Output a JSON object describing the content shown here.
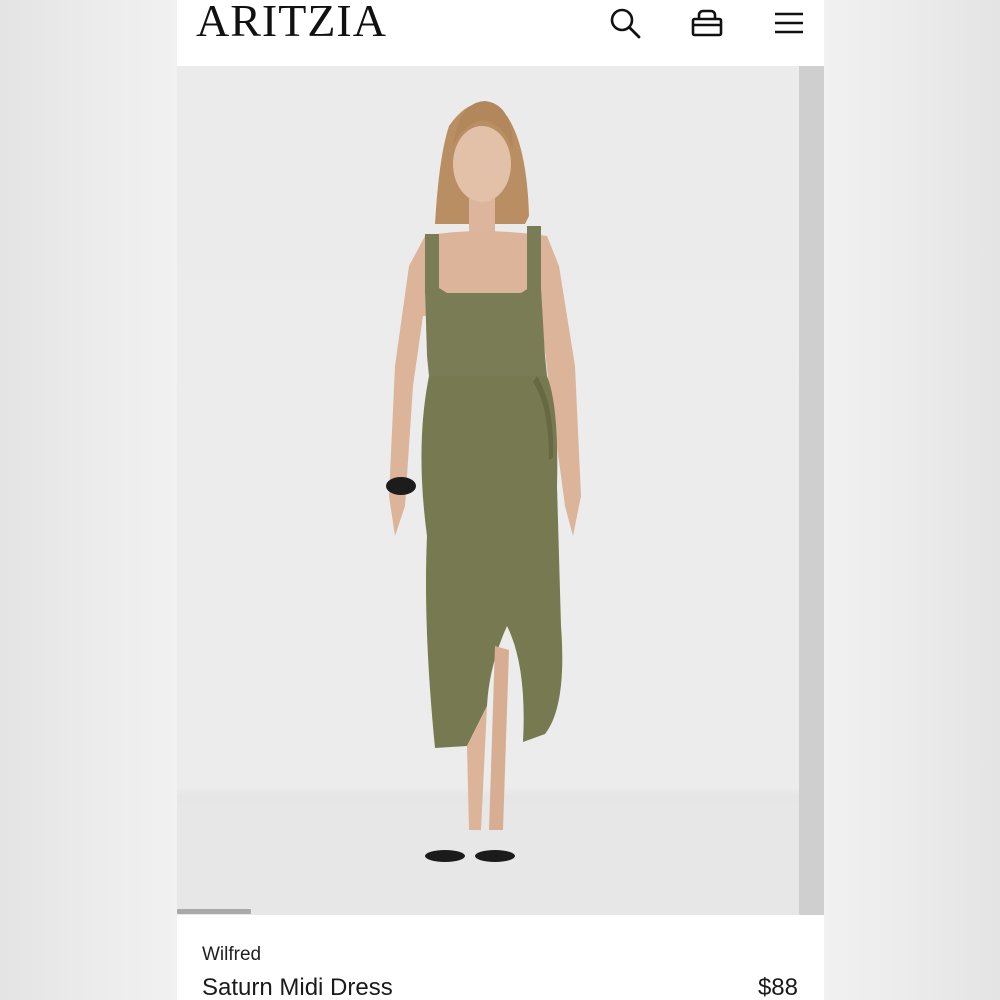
{
  "header": {
    "logo": "ARITZIA",
    "icons": [
      "search-icon",
      "bag-icon",
      "menu-icon"
    ]
  },
  "gallery": {
    "image": "model-wearing-olive-wrap-midi-dress",
    "dress_color": "#7a7c55"
  },
  "product": {
    "brand": "Wilfred",
    "name": "Saturn Midi Dress",
    "price": "$88"
  }
}
